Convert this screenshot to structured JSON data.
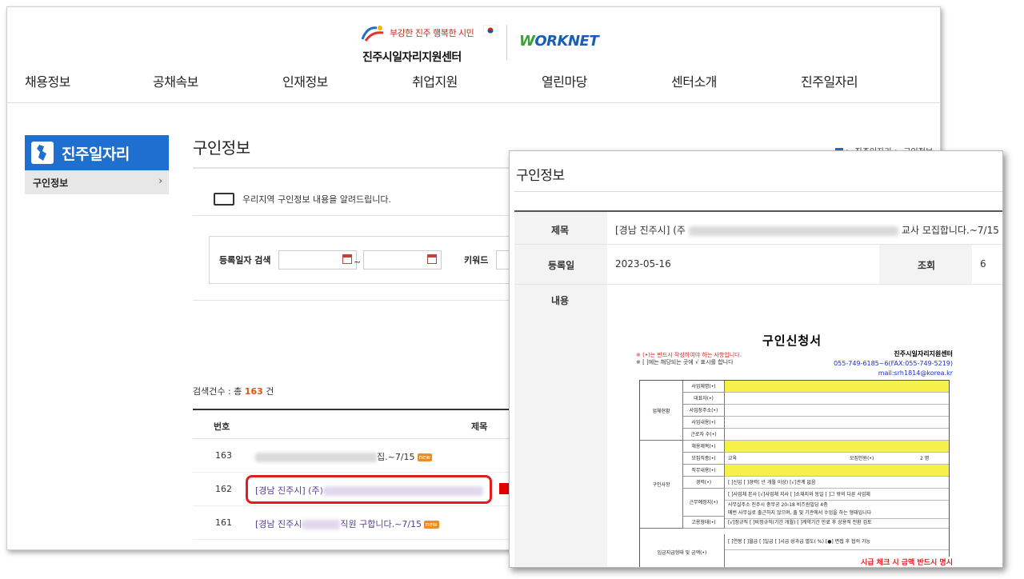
{
  "header": {
    "slogan": "부강한 진주 행복한 시민",
    "center_name": "진주시일자리지원센터",
    "worknet_rest": "ORKNET",
    "worknet_w": "W"
  },
  "gnb": [
    "채용정보",
    "공채속보",
    "인재정보",
    "취업지원",
    "열린마당",
    "센터소개",
    "진주일자리"
  ],
  "lnb": {
    "title": "진주일자리",
    "item": "구인정보",
    "chevron": "›"
  },
  "page": {
    "title": "구인정보",
    "breadcrumb": "> 진주일자리 > 구인정보",
    "intro": "우리지역 구인정보 내용을 알려드립니다."
  },
  "search": {
    "date_label": "등록일자 검색",
    "tilde": "~",
    "keyword_label": "키워드"
  },
  "results": {
    "count_prefix": "검색건수 : 총 ",
    "count": "163",
    "count_suffix": " 건",
    "col_num": "번호",
    "col_title": "제목",
    "rows": [
      {
        "num": "163",
        "suffix": "집.~7/15"
      },
      {
        "num": "162",
        "prefix": "[경남 진주시] (주)"
      },
      {
        "num": "161",
        "prefix": "[경남 진주시",
        "suffix": "직원 구합니다.~7/15"
      }
    ],
    "new_badge": "new"
  },
  "detail": {
    "title": "구인정보",
    "subject_label": "제목",
    "subject_prefix": "[경남 진주시] (주",
    "subject_suffix": "교사 모집합니다.~7/15",
    "date_label": "등록일",
    "date_value": "2023-05-16",
    "hits_label": "조회",
    "hits_value": "6",
    "content_label": "내용"
  },
  "form": {
    "title": "구인신청서",
    "note1": "※ (•)는 반드시 작성하여야 하는 사항입니다.",
    "note2": "※ [   ]에는 해당되는 곳에 √ 표시를 합니다",
    "center": "진주시일자리지원센터",
    "phone": "055-749-6185~6(FAX:055-749-5219)",
    "mail": "mail:srh1814@korea.kr",
    "sec_company": "업체현황",
    "sec_recruit": "구인사항",
    "labels": [
      "사업체명(•)",
      "대표자(•)",
      "사업장주소(•)",
      "사업내용(•)",
      "근로자 수(•)",
      "채용제목(•)",
      "모집직종(•)",
      "직무내용(•)",
      "경력(•)",
      "근무예정지(•)",
      "",
      "고용형태(•)",
      "임금지급형태 및 금액(•)"
    ],
    "recruit_type": "교육",
    "headcount_label": "모집인원(•)",
    "headcount_value": "2 명",
    "career_text": "[  ]신입    [  ]경력(    년    개월 이상)    [√]관계 없음",
    "workplace_text": "[  ]사업체 본사  [√]사업체 지사  [  ]소재지와 동일  [  ]그 밖의 다른 사업체",
    "workplace_addr": "사무실주소  진주시 충무공 20-18 비즈원빌딩 4층",
    "workplace_note": "매번 사무실로 출근하지 않으며, 출 및 기관에서 수업을 하는 형태입니다",
    "employ_text": "[√]정규직   [  ]비정규직(기간   개월)  [  ]계약기간 만료 후 상용직 전환 검토",
    "wage_text": "[  ]연봉   [  ]월급   [  ]일급   [  ]시급    성과급 별도(   %)   [●] 면접 후 협의 가능",
    "red_note": "시급 체크 시 금액 반드시 명시"
  }
}
